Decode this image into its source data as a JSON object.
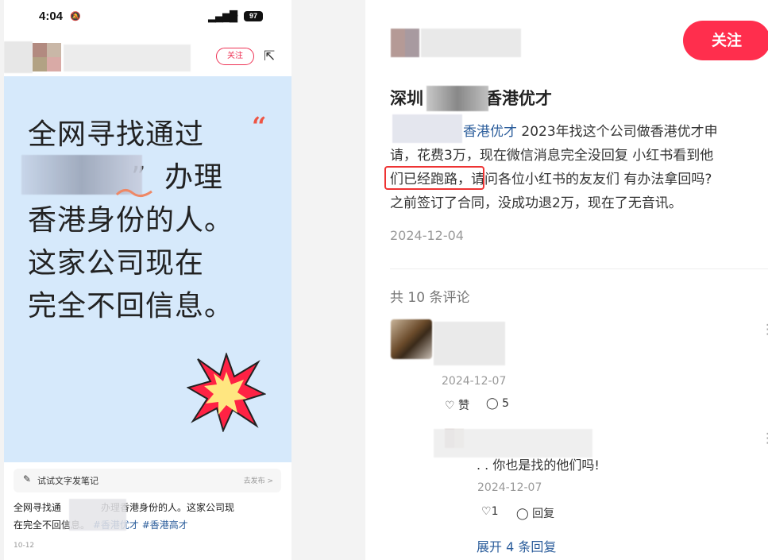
{
  "status_bar": {
    "time": "4:04",
    "battery": "97"
  },
  "phone": {
    "follow_label": "关注",
    "cover_lines": [
      "全网寻找通过",
      "办理",
      "香港身份的人。",
      "这家公司现在",
      "完全不回信息。"
    ],
    "cover_quote_open": "“",
    "cover_quote_close": "”",
    "try_label": "试试文字发笔记",
    "publish_label": "去发布 >",
    "note_text_1": "全网寻找通",
    "note_text_2": "办理香港身份的人。这家公司现",
    "note_text_3": "在完全不回信息。",
    "tag1": "#香港优才",
    "tag2": "#香港高才",
    "note_date": "10-12"
  },
  "panel": {
    "follow_label": "关注",
    "title_prefix": "深圳",
    "title_suffix": "香港优才",
    "body_line1_tag": "香港优才",
    "body_line1": "2023年找这个公司做香港优才申",
    "body_line2": "请，花费3万，现在微信消息完全没回复 小红书看到他",
    "body_line3_hl": "们已经跑路，",
    "body_line3": "请问各位小红书的友友们 有办法拿回吗?",
    "body_line4": "之前签订了合同，没成功退2万，现在了无音讯。",
    "post_date": "2024-12-04",
    "comment_count": "共 10 条评论",
    "comment1": {
      "date": "2024-12-07",
      "like_label": "赞",
      "reply_count": "5"
    },
    "reply1": {
      "text": "你也是找的他们吗!",
      "prefix": ". .",
      "date": "2024-12-07",
      "like_count": "1",
      "reply_label": "回复"
    },
    "expand_label": "展开 4 条回复"
  }
}
